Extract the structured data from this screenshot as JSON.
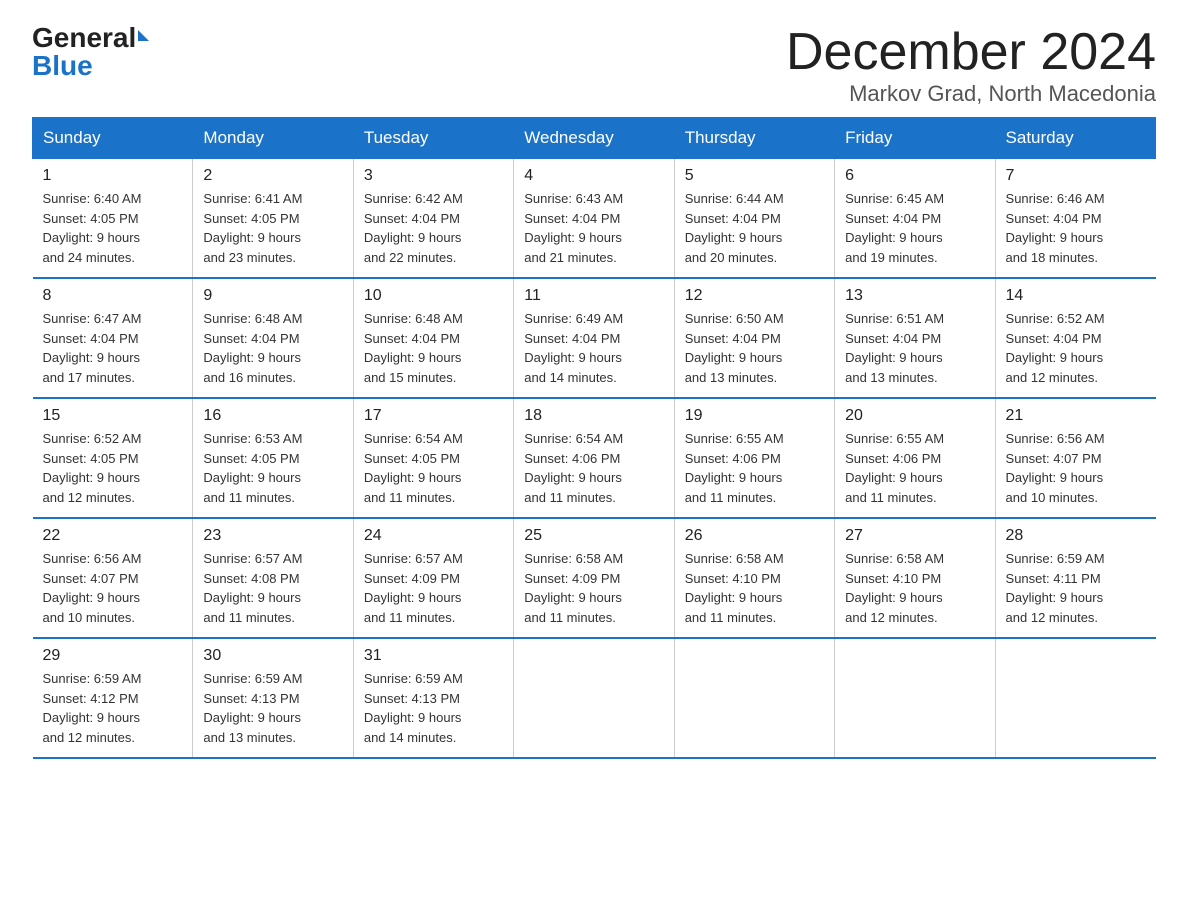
{
  "logo": {
    "general": "General",
    "blue": "Blue"
  },
  "title": "December 2024",
  "subtitle": "Markov Grad, North Macedonia",
  "weekdays": [
    "Sunday",
    "Monday",
    "Tuesday",
    "Wednesday",
    "Thursday",
    "Friday",
    "Saturday"
  ],
  "weeks": [
    [
      {
        "day": "1",
        "sunrise": "6:40 AM",
        "sunset": "4:05 PM",
        "daylight": "9 hours and 24 minutes."
      },
      {
        "day": "2",
        "sunrise": "6:41 AM",
        "sunset": "4:05 PM",
        "daylight": "9 hours and 23 minutes."
      },
      {
        "day": "3",
        "sunrise": "6:42 AM",
        "sunset": "4:04 PM",
        "daylight": "9 hours and 22 minutes."
      },
      {
        "day": "4",
        "sunrise": "6:43 AM",
        "sunset": "4:04 PM",
        "daylight": "9 hours and 21 minutes."
      },
      {
        "day": "5",
        "sunrise": "6:44 AM",
        "sunset": "4:04 PM",
        "daylight": "9 hours and 20 minutes."
      },
      {
        "day": "6",
        "sunrise": "6:45 AM",
        "sunset": "4:04 PM",
        "daylight": "9 hours and 19 minutes."
      },
      {
        "day": "7",
        "sunrise": "6:46 AM",
        "sunset": "4:04 PM",
        "daylight": "9 hours and 18 minutes."
      }
    ],
    [
      {
        "day": "8",
        "sunrise": "6:47 AM",
        "sunset": "4:04 PM",
        "daylight": "9 hours and 17 minutes."
      },
      {
        "day": "9",
        "sunrise": "6:48 AM",
        "sunset": "4:04 PM",
        "daylight": "9 hours and 16 minutes."
      },
      {
        "day": "10",
        "sunrise": "6:48 AM",
        "sunset": "4:04 PM",
        "daylight": "9 hours and 15 minutes."
      },
      {
        "day": "11",
        "sunrise": "6:49 AM",
        "sunset": "4:04 PM",
        "daylight": "9 hours and 14 minutes."
      },
      {
        "day": "12",
        "sunrise": "6:50 AM",
        "sunset": "4:04 PM",
        "daylight": "9 hours and 13 minutes."
      },
      {
        "day": "13",
        "sunrise": "6:51 AM",
        "sunset": "4:04 PM",
        "daylight": "9 hours and 13 minutes."
      },
      {
        "day": "14",
        "sunrise": "6:52 AM",
        "sunset": "4:04 PM",
        "daylight": "9 hours and 12 minutes."
      }
    ],
    [
      {
        "day": "15",
        "sunrise": "6:52 AM",
        "sunset": "4:05 PM",
        "daylight": "9 hours and 12 minutes."
      },
      {
        "day": "16",
        "sunrise": "6:53 AM",
        "sunset": "4:05 PM",
        "daylight": "9 hours and 11 minutes."
      },
      {
        "day": "17",
        "sunrise": "6:54 AM",
        "sunset": "4:05 PM",
        "daylight": "9 hours and 11 minutes."
      },
      {
        "day": "18",
        "sunrise": "6:54 AM",
        "sunset": "4:06 PM",
        "daylight": "9 hours and 11 minutes."
      },
      {
        "day": "19",
        "sunrise": "6:55 AM",
        "sunset": "4:06 PM",
        "daylight": "9 hours and 11 minutes."
      },
      {
        "day": "20",
        "sunrise": "6:55 AM",
        "sunset": "4:06 PM",
        "daylight": "9 hours and 11 minutes."
      },
      {
        "day": "21",
        "sunrise": "6:56 AM",
        "sunset": "4:07 PM",
        "daylight": "9 hours and 10 minutes."
      }
    ],
    [
      {
        "day": "22",
        "sunrise": "6:56 AM",
        "sunset": "4:07 PM",
        "daylight": "9 hours and 10 minutes."
      },
      {
        "day": "23",
        "sunrise": "6:57 AM",
        "sunset": "4:08 PM",
        "daylight": "9 hours and 11 minutes."
      },
      {
        "day": "24",
        "sunrise": "6:57 AM",
        "sunset": "4:09 PM",
        "daylight": "9 hours and 11 minutes."
      },
      {
        "day": "25",
        "sunrise": "6:58 AM",
        "sunset": "4:09 PM",
        "daylight": "9 hours and 11 minutes."
      },
      {
        "day": "26",
        "sunrise": "6:58 AM",
        "sunset": "4:10 PM",
        "daylight": "9 hours and 11 minutes."
      },
      {
        "day": "27",
        "sunrise": "6:58 AM",
        "sunset": "4:10 PM",
        "daylight": "9 hours and 12 minutes."
      },
      {
        "day": "28",
        "sunrise": "6:59 AM",
        "sunset": "4:11 PM",
        "daylight": "9 hours and 12 minutes."
      }
    ],
    [
      {
        "day": "29",
        "sunrise": "6:59 AM",
        "sunset": "4:12 PM",
        "daylight": "9 hours and 12 minutes."
      },
      {
        "day": "30",
        "sunrise": "6:59 AM",
        "sunset": "4:13 PM",
        "daylight": "9 hours and 13 minutes."
      },
      {
        "day": "31",
        "sunrise": "6:59 AM",
        "sunset": "4:13 PM",
        "daylight": "9 hours and 14 minutes."
      },
      null,
      null,
      null,
      null
    ]
  ],
  "labels": {
    "sunrise": "Sunrise:",
    "sunset": "Sunset:",
    "daylight": "Daylight:"
  }
}
